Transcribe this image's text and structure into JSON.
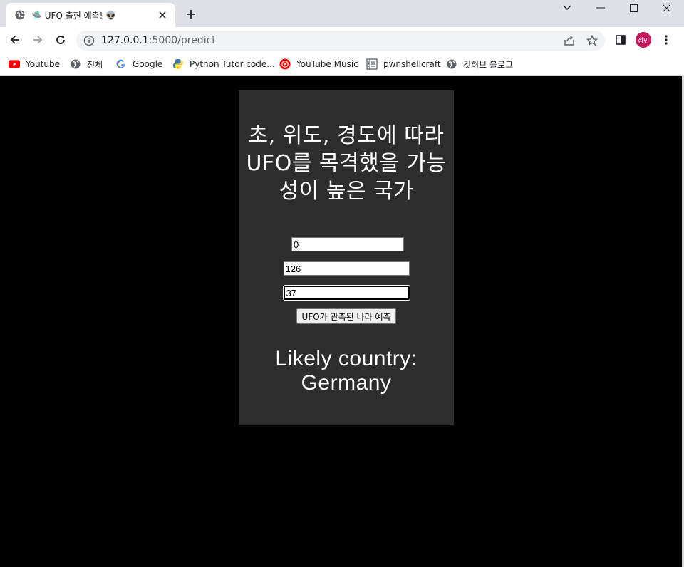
{
  "browser": {
    "tab": {
      "title": "🛸 UFO 출현 예측! 👽"
    },
    "omnibox": {
      "host": "127.0.0.1",
      "path": ":5000/predict"
    },
    "profile": {
      "initials": "정민",
      "color": "#c2185b"
    },
    "bookmarks": [
      {
        "label": "Youtube",
        "icon": "youtube-icon"
      },
      {
        "label": "전체",
        "icon": "globe-icon"
      },
      {
        "label": "Google",
        "icon": "google-icon"
      },
      {
        "label": "Python Tutor code...",
        "icon": "python-icon"
      },
      {
        "label": "YouTube Music",
        "icon": "youtube-music-icon"
      },
      {
        "label": "pwnshellcraft",
        "icon": "document-icon"
      },
      {
        "label": "깃허브 블로그",
        "icon": "globe-icon"
      }
    ]
  },
  "page": {
    "heading": "초, 위도, 경도에 따라 UFO를 목격했을 가능성이 높은 국가",
    "inputs": {
      "seconds": "0",
      "latitude": "126",
      "longitude": "37"
    },
    "submit_label": "UFO가 관측된 나라 예측",
    "result_line1": "Likely country:",
    "result_line2": "Germany",
    "colors": {
      "panel_bg": "#2d2d2d",
      "page_bg": "#000000",
      "text": "#ffffff"
    }
  }
}
